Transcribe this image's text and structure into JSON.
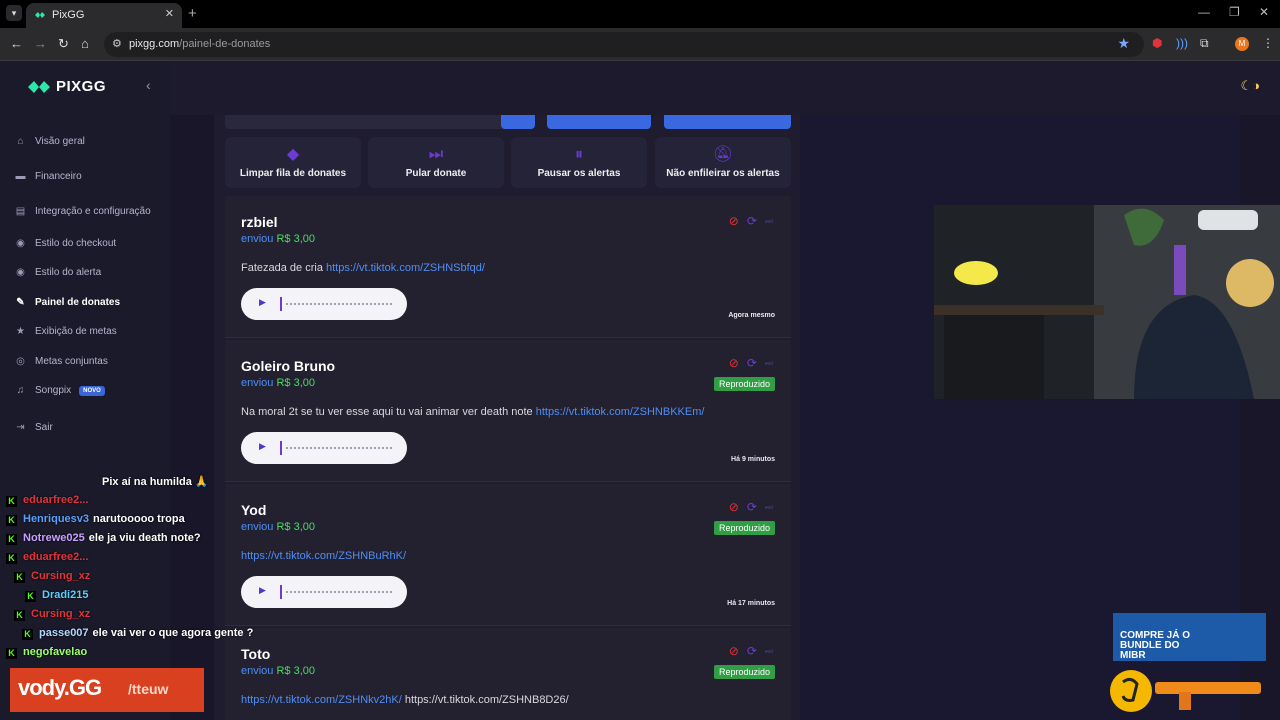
{
  "browser": {
    "tab_title": "PixGG",
    "url_domain": "pixgg.com",
    "url_path": "/painel-de-donates",
    "profile_initial": "M"
  },
  "sidebar": {
    "brand": "PIXGG",
    "items": [
      {
        "label": "Visão geral",
        "icon": "home-icon"
      },
      {
        "label": "Financeiro",
        "icon": "wallet-icon"
      },
      {
        "label": "Integração e configuração",
        "icon": "settings-icon"
      },
      {
        "label": "Estilo do checkout",
        "icon": "palette-icon"
      },
      {
        "label": "Estilo do alerta",
        "icon": "palette-icon"
      },
      {
        "label": "Painel de donates",
        "icon": "broom-icon",
        "active": true
      },
      {
        "label": "Exibição de metas",
        "icon": "star-icon"
      },
      {
        "label": "Metas conjuntas",
        "icon": "target-icon"
      },
      {
        "label": "Songpix",
        "icon": "music-icon",
        "badge": "NOVO"
      },
      {
        "label": "Sair",
        "icon": "logout-icon"
      }
    ]
  },
  "actions": [
    {
      "label": "Limpar fila de donates",
      "icon": "eraser-icon"
    },
    {
      "label": "Pular donate",
      "icon": "skip-icon"
    },
    {
      "label": "Pausar os alertas",
      "icon": "pause-icon"
    },
    {
      "label": "Não enfileirar os alertas",
      "icon": "bell-off-icon"
    }
  ],
  "donations": [
    {
      "name": "rzbiel",
      "sent_label": "enviou",
      "amount": "R$ 3,00",
      "message": "Fatezada de cria ",
      "links": [
        "https://vt.tiktok.com/ZSHNSbfqd/"
      ],
      "time": "Agora mesmo",
      "status": ""
    },
    {
      "name": "Goleiro Bruno",
      "sent_label": "enviou",
      "amount": "R$ 3,00",
      "message": "Na moral 2t se tu ver esse aqui tu vai animar ver death note ",
      "links": [
        "https://vt.tiktok.com/ZSHNBKKEm/"
      ],
      "time": "Há 9 minutos",
      "status": "Reproduzido"
    },
    {
      "name": "Yod",
      "sent_label": "enviou",
      "amount": "R$ 3,00",
      "message": "",
      "links": [
        "https://vt.tiktok.com/ZSHNBuRhK/"
      ],
      "time": "Há 17 minutos",
      "status": "Reproduzido"
    },
    {
      "name": "Toto",
      "sent_label": "enviou",
      "amount": "R$ 3,00",
      "message": "",
      "links": [
        "https://vt.tiktok.com/ZSHNkv2hK/",
        " https://vt.tiktok.com/ZSHNB8D26/"
      ],
      "time": "",
      "status": "Reproduzido"
    }
  ],
  "chat": [
    {
      "user": "",
      "color": "#ffffff",
      "text": "Pix aí na humilda 🙏"
    },
    {
      "user": "eduarfree2...",
      "color": "#e0343a",
      "text": ""
    },
    {
      "user": "Henriquesv3",
      "color": "#5aa0ff",
      "text": "narutooooo tropa"
    },
    {
      "user": "Notrewe025",
      "color": "#c9a0ff",
      "text": "ele ja viu death note?"
    },
    {
      "user": "eduarfree2...",
      "color": "#e0343a",
      "text": ""
    },
    {
      "user": "Cursing_xz",
      "color": "#e0343a",
      "text": ""
    },
    {
      "user": "Dradi215",
      "color": "#5ad0ff",
      "text": ""
    },
    {
      "user": "Cursing_xz",
      "color": "#e0343a",
      "text": ""
    },
    {
      "user": "passe007",
      "color": "#b0d8ff",
      "text": "ele vai ver o que agora gente ?"
    },
    {
      "user": "negofavelao",
      "color": "#9dff6a",
      "text": ""
    }
  ],
  "overlay": {
    "vody_brand": "vody.GG",
    "vody_handle": "/tteuw",
    "promo_text": "COMPRE JÁ O BUNDLE DO MIBR"
  },
  "colors": {
    "accent": "#6b3bd6",
    "link": "#4f8ef5",
    "amount": "#4cd964",
    "status": "#2f9e44",
    "danger": "#e0343a"
  }
}
